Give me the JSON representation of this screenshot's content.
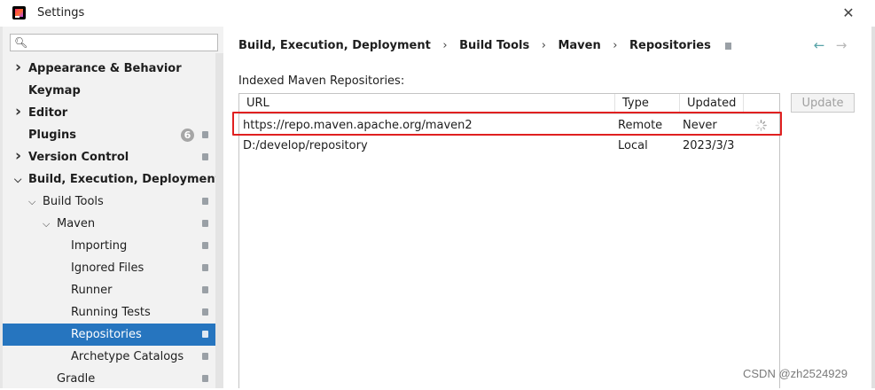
{
  "window": {
    "title": "Settings"
  },
  "search": {
    "value": "",
    "placeholder": ""
  },
  "sidebar": {
    "items": [
      {
        "label": "Appearance & Behavior",
        "chevron": "right"
      },
      {
        "label": "Keymap"
      },
      {
        "label": "Editor",
        "chevron": "right"
      },
      {
        "label": "Plugins",
        "badge": "6"
      },
      {
        "label": "Version Control",
        "chevron": "right"
      },
      {
        "label": "Build, Execution, Deployment",
        "chevron": "down"
      },
      {
        "label": "Build Tools",
        "chevron": "down"
      },
      {
        "label": "Maven",
        "chevron": "down"
      },
      {
        "label": "Importing"
      },
      {
        "label": "Ignored Files"
      },
      {
        "label": "Runner"
      },
      {
        "label": "Running Tests"
      },
      {
        "label": "Repositories",
        "selected": true
      },
      {
        "label": "Archetype Catalogs"
      },
      {
        "label": "Gradle"
      }
    ]
  },
  "breadcrumb": [
    "Build, Execution, Deployment",
    "Build Tools",
    "Maven",
    "Repositories"
  ],
  "panel": {
    "section_label": "Indexed Maven Repositories:",
    "update_button": "Update"
  },
  "table": {
    "headers": [
      "URL",
      "Type",
      "Updated"
    ],
    "rows": [
      {
        "url": "https://repo.maven.apache.org/maven2",
        "type": "Remote",
        "updated": "Never",
        "loading": true
      },
      {
        "url": "D:/develop/repository",
        "type": "Local",
        "updated": "2023/3/3"
      }
    ]
  },
  "watermark": "CSDN @zh2524929",
  "colors": {
    "selection": "#2675bf",
    "highlight": "#e02020"
  }
}
